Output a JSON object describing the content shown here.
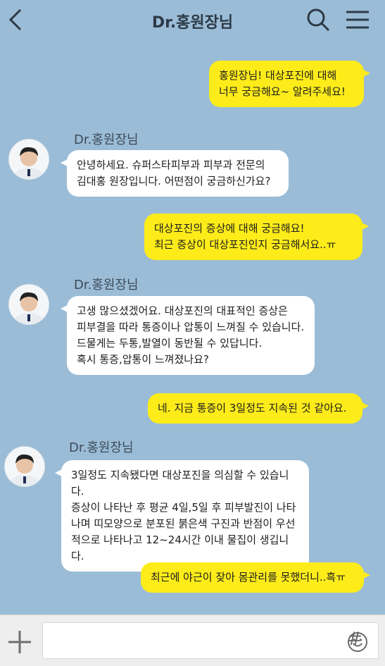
{
  "header": {
    "title": "Dr.홍원장님",
    "back_icon": "chevron-left-icon",
    "search_icon": "search-icon",
    "menu_icon": "hamburger-menu-icon"
  },
  "messages": [
    {
      "from": "me",
      "text": "홍원장님! 대상포진에 대해\n너무 궁금해요~ 알려주세요!"
    },
    {
      "from": "doctor",
      "sender": "Dr.홍원장님",
      "text": "안녕하세요. 슈퍼스타피부과 피부과 전문의\n김대홍 원장입니다. 어떤점이 궁금하신가요?"
    },
    {
      "from": "me",
      "text": "대상포진의 증상에 대해 궁금해요!\n최근 증상이 대상포진인지 궁금해서요..ㅠ"
    },
    {
      "from": "doctor",
      "sender": "Dr.홍원장님",
      "text": "고생 많으셨겠어요. 대상포진의 대표적인 증상은\n피부결을 따라 통증이나 압통이 느껴질 수 있습니다.\n드물게는 두통,발열이 동반될 수 있답니다.\n혹시 통증,압통이 느껴졌나요?"
    },
    {
      "from": "me",
      "text": "네. 지금 통증이 3일정도 지속된 것 같아요."
    },
    {
      "from": "doctor",
      "sender": "Dr.홍원장님",
      "text": "3일정도 지속됐다면 대상포진을 의심할 수 있습니다.\n증상이 나타난 후 평균 4일,5일 후 피부발진이 나타\n나며 띠모양으로 분포된 붉은색 구진과 반점이 우선\n적으로 나타나고 12~24시간 이내 물집이 생깁니다."
    },
    {
      "from": "me",
      "text": "최근에 야근이 잦아 몸관리를 못했더니..흑ㅠ"
    }
  ],
  "input": {
    "value": "",
    "plus_icon": "plus-icon",
    "emoji_icon": "smiley-icon",
    "hash_label": "#"
  },
  "colors": {
    "background": "#9bbcd6",
    "my_bubble": "#fdec1a",
    "their_bubble": "#ffffff"
  }
}
